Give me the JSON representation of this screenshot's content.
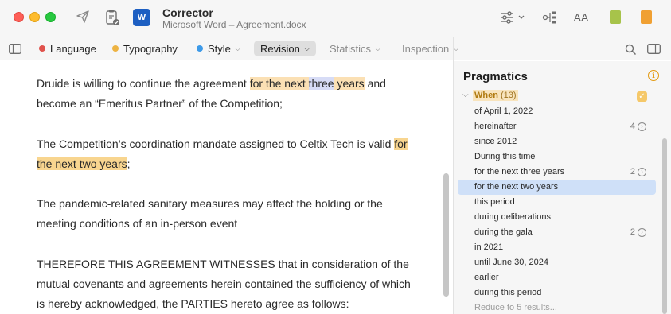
{
  "window": {
    "app_name": "Corrector",
    "document_name": "Microsoft Word – Agreement.docx",
    "icons": [
      "send-icon",
      "document-check-icon",
      "word-app-icon",
      "sliders-icon",
      "hierarchy-icon",
      "text-size-icon",
      "green-book-icon",
      "orange-book-icon"
    ],
    "text_size_glyph": "AA",
    "word_glyph": "W"
  },
  "toolbar": {
    "language": {
      "label": "Language",
      "color": "#e0524c"
    },
    "typography": {
      "label": "Typography",
      "color": "#edb342"
    },
    "style": {
      "label": "Style",
      "color": "#3d9ae8"
    },
    "revision": {
      "label": "Revision"
    },
    "statistics": {
      "label": "Statistics"
    },
    "inspection": {
      "label": "Inspection"
    },
    "chevron": "⌵"
  },
  "document": {
    "p1": {
      "t1": "Druide is willing to continue the agreement ",
      "h1": "for the next ",
      "h2": "three",
      "h3": " years",
      "t2": " and become an “Emeritus Partner” of the Competition;"
    },
    "p2": {
      "t1": "The Competition’s coordination mandate assigned to Celtix Tech is valid ",
      "h1": "for the next two years",
      "t2": ";"
    },
    "p3": "The pandemic-related sanitary measures may affect the holding or the meeting conditions of an in-person event",
    "p4": "THEREFORE THIS AGREEMENT WITNESSES that in consideration of the mutual covenants and agreements herein contained the sufficiency of which is hereby acknowledged, the PARTIES hereto agree as follows:"
  },
  "sidebar": {
    "title": "Pragmatics",
    "info_glyph": "i",
    "group": {
      "label": "When",
      "count": "(13)",
      "check_glyph": "✓"
    },
    "items": [
      {
        "label": "of April 1, 2022",
        "count": ""
      },
      {
        "label": "hereinafter",
        "count": "4"
      },
      {
        "label": "since 2012",
        "count": ""
      },
      {
        "label": "During this time",
        "count": ""
      },
      {
        "label": "for the next three years",
        "count": "2"
      },
      {
        "label": "for the next two years",
        "count": "",
        "selected": true
      },
      {
        "label": "this period",
        "count": ""
      },
      {
        "label": "during deliberations",
        "count": ""
      },
      {
        "label": "during the gala",
        "count": "2"
      },
      {
        "label": "in 2021",
        "count": ""
      },
      {
        "label": "until June 30, 2024",
        "count": ""
      },
      {
        "label": "earlier",
        "count": ""
      },
      {
        "label": "during this period",
        "count": ""
      }
    ],
    "footer": "Reduce to 5 results..."
  }
}
